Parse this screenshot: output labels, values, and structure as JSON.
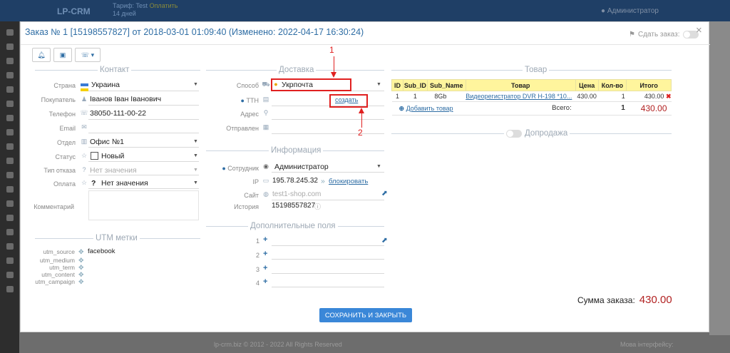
{
  "bg": {
    "logo": "LP-CRM",
    "tariff_line1": "Тариф: Test",
    "tariff_badge": "Оплатить",
    "tariff_line2": "14 дней",
    "admin": "Администратор",
    "footer": "lp-crm.biz © 2012 - 2022 All Rights Reserved",
    "footer_right": "Мова інтерфейсу:"
  },
  "modal": {
    "title": "Заказ № 1 [15198557827] от 2018-03-01 01:09:40 (Изменено: 2022-04-17 16:30:24)",
    "sdat_label": "Сдать заказ:",
    "close": "×"
  },
  "contact": {
    "section": "Контакт",
    "country_label": "Страна",
    "country_value": "Украина",
    "buyer_label": "Покупатель",
    "buyer_value": "Іванов Іван Іванович",
    "phone_label": "Телефон",
    "phone_value": "38050-111-00-22",
    "email_label": "Email",
    "email_value": "",
    "dept_label": "Отдел",
    "dept_value": "Офис №1",
    "status_label": "Статус",
    "status_value": "Новый",
    "refuse_label": "Тип отказа",
    "refuse_value": "Нет значения",
    "pay_label": "Оплата",
    "pay_value": "Нет значения",
    "comment_label": "Комментарий"
  },
  "utm": {
    "section": "UTM метки",
    "source_label": "utm_source",
    "source_value": "facebook",
    "medium_label": "utm_medium",
    "term_label": "utm_term",
    "content_label": "utm_content",
    "campaign_label": "utm_campaign"
  },
  "delivery": {
    "section": "Доставка",
    "method_label": "Способ",
    "method_value": "Укрпочта",
    "ttn_label": "ТТН",
    "create_link": "создать",
    "address_label": "Адрес",
    "sent_label": "Отправлен"
  },
  "info": {
    "section": "Информация",
    "employee_label": "Сотрудник",
    "employee_value": "Администратор",
    "ip_label": "IP",
    "ip_value": "195.78.245.32",
    "block_link": "блокировать",
    "site_label": "Сайт",
    "site_value": "test1-shop.com",
    "history_label": "История",
    "history_value": "15198557827"
  },
  "extra": {
    "section": "Дополнительные поля",
    "n1": "1",
    "n2": "2",
    "n3": "3",
    "n4": "4"
  },
  "goods": {
    "section": "Товар",
    "headers": [
      "ID",
      "Sub_ID",
      "Sub_Name",
      "Товар",
      "Цена",
      "Кол-во",
      "Итого"
    ],
    "row": {
      "id": "1",
      "sub_id": "1",
      "sub_name": "8Gb",
      "product": "Видеорегистратор DVR H-198 *10...",
      "price": "430.00",
      "qty": "1",
      "total": "430.00"
    },
    "add_link": "Добавить товар",
    "all_label": "Всего:",
    "all_qty": "1",
    "all_total": "430.00"
  },
  "upsell": {
    "section": "Допродажа"
  },
  "summary": {
    "label": "Сумма заказа:",
    "value": "430.00"
  },
  "save_button": "СОХРАНИТЬ И ЗАКРЫТЬ",
  "annotations": {
    "one": "1",
    "two": "2"
  },
  "colors": {
    "accent": "#2e6da4",
    "highlight": "#e02020",
    "table_header": "#fff59d",
    "save": "#3a87d8"
  }
}
